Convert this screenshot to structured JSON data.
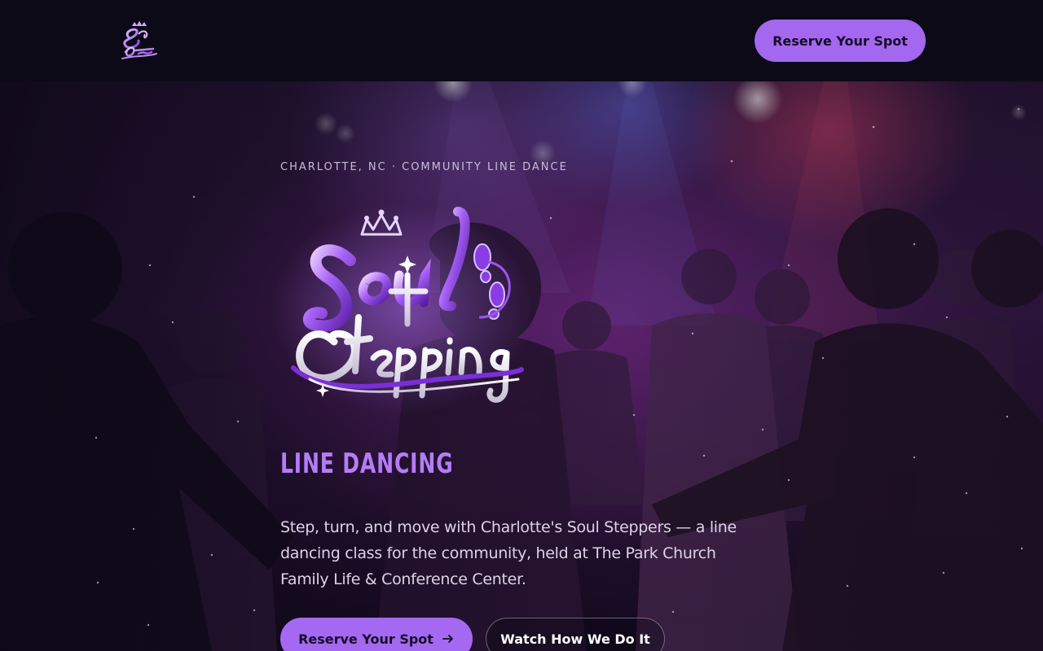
{
  "header": {
    "logo_icon": "soul-stepping-logo",
    "cta_label": "Reserve Your Spot"
  },
  "hero": {
    "eyebrow": "CHARLOTTE, NC · COMMUNITY LINE DANCE",
    "logo_icon": "soul-stepping-logo",
    "headline": "LINE DANCING",
    "description": "Step, turn, and move with Charlotte's Soul Steppers — a line dancing class for the community, held at The Park Church Family Life & Conference Center.",
    "primary_cta": {
      "label": "Reserve Your Spot",
      "icon": "arrow-right-icon"
    },
    "secondary_cta": {
      "label": "Watch How We Do It"
    }
  },
  "colors": {
    "accent": "#a468f1",
    "headline": "#b57cf7",
    "background": "#0c0a17"
  }
}
